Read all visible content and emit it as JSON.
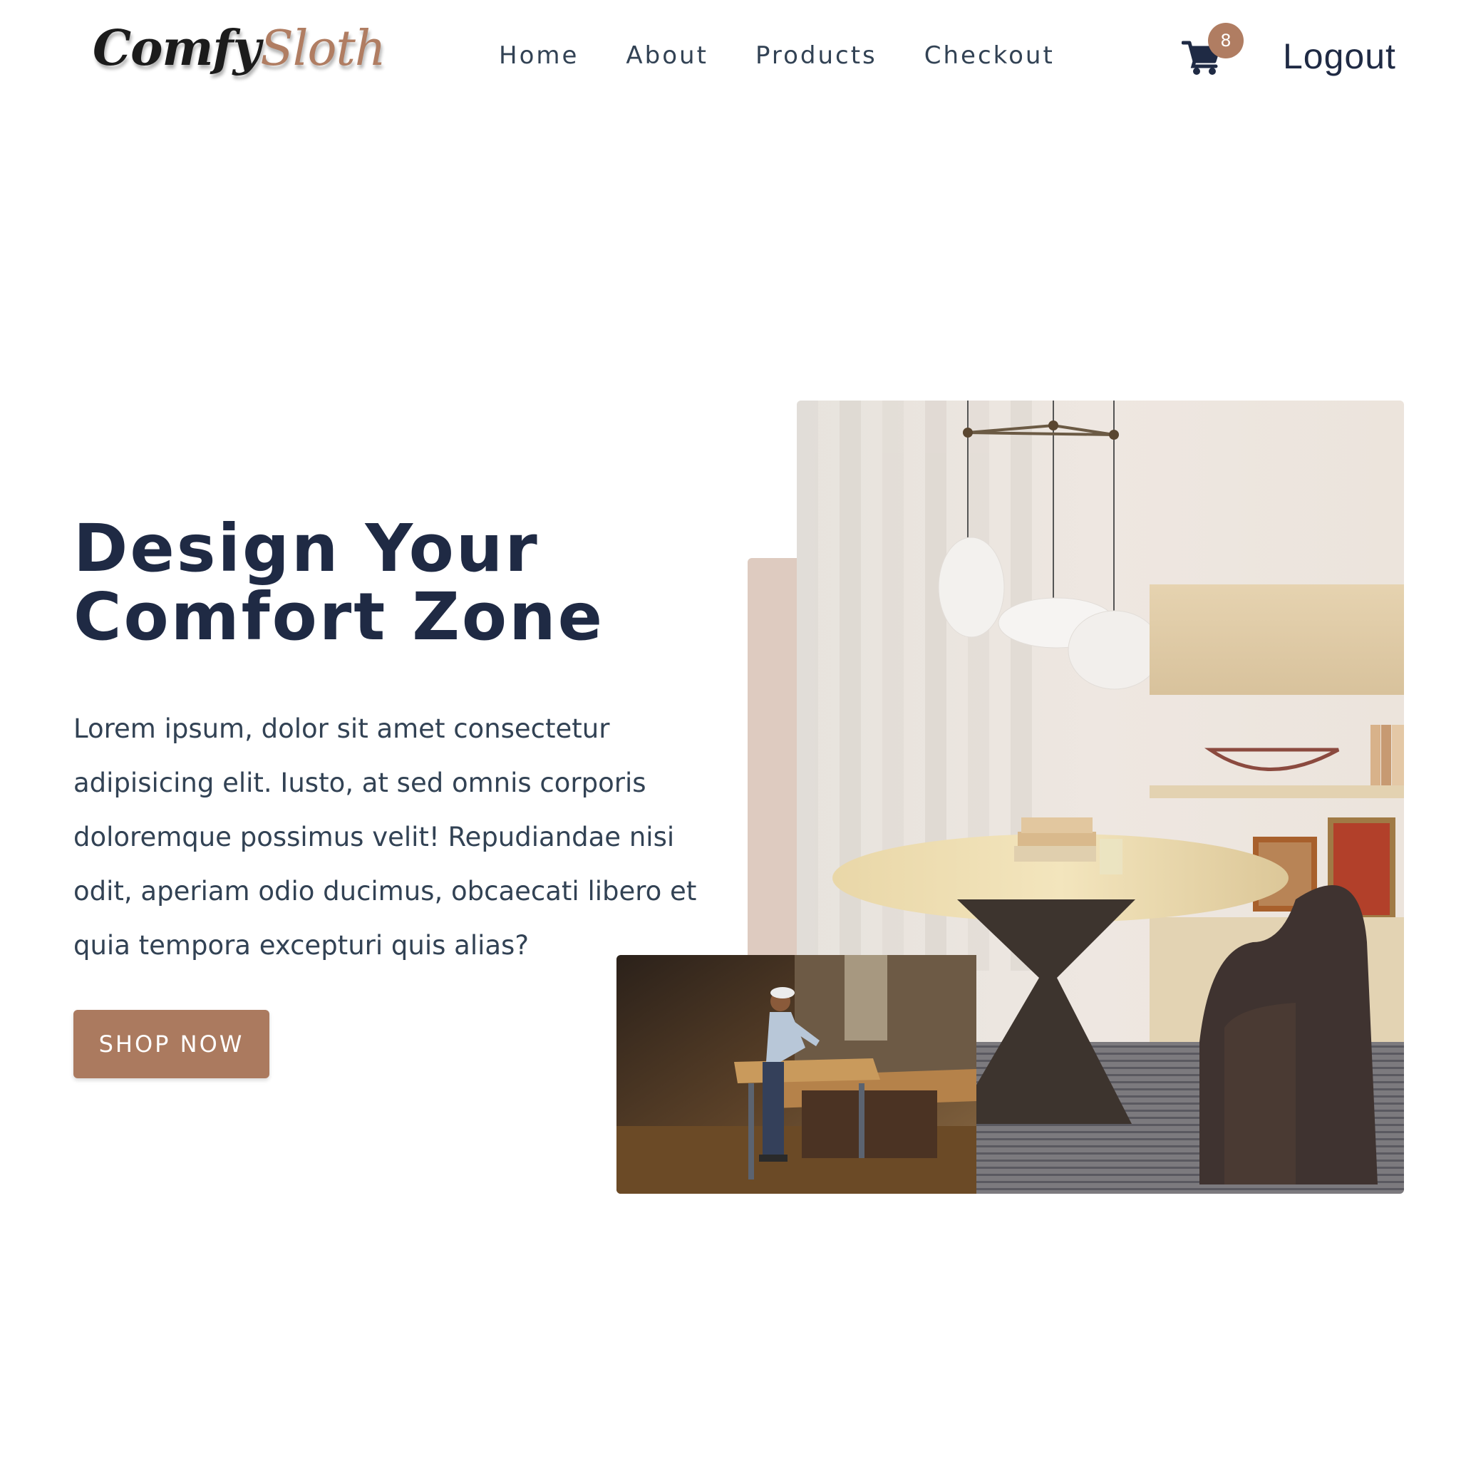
{
  "navbar": {
    "logo": {
      "part1": "Comfy",
      "part2": "Sloth"
    },
    "links": [
      {
        "label": "Home"
      },
      {
        "label": "About"
      },
      {
        "label": "Products"
      },
      {
        "label": "Checkout"
      }
    ],
    "cart": {
      "icon": "cart-icon",
      "count": "8"
    },
    "logout_label": "Logout"
  },
  "hero": {
    "title_line1": "Design Your",
    "title_line2": "Comfort Zone",
    "text": "Lorem ipsum, dolor sit amet consectetur adipisicing elit. Iusto, at sed omnis corporis doloremque possimus velit! Repudiandae nisi odit, aperiam odio ducimus, obcaecati libero et quia tempora excepturi quis alias?",
    "button_label": "SHOP NOW"
  },
  "colors": {
    "primary_dark": "#1f2a44",
    "accent": "#ab7a5f",
    "accent_light": "#decbc0",
    "text": "#324254",
    "background": "#ffffff"
  }
}
